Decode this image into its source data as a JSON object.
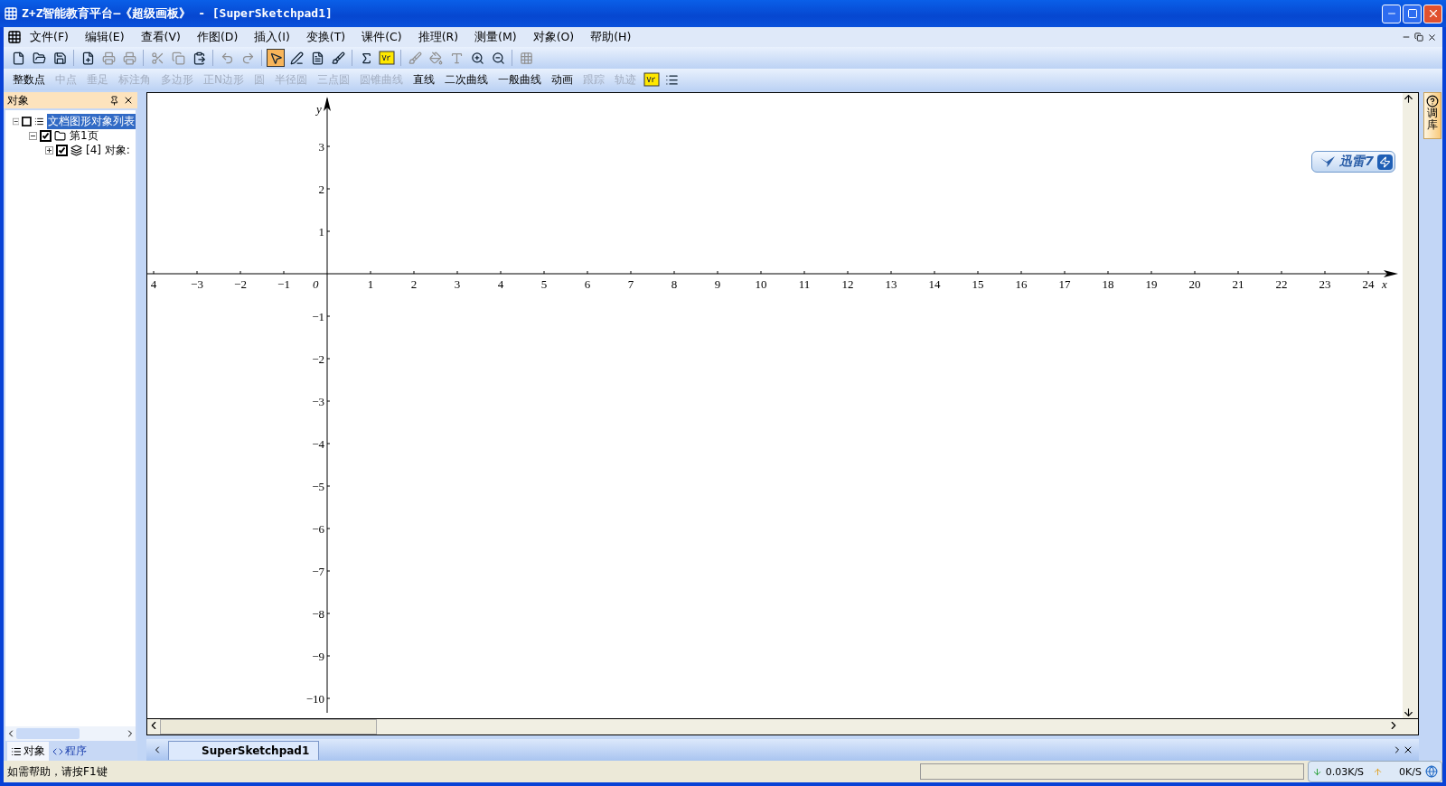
{
  "window": {
    "title": "Z+Z智能教育平台—《超级画板》 - [SuperSketchpad1]"
  },
  "menu": [
    "文件(F)",
    "编辑(E)",
    "查看(V)",
    "作图(D)",
    "插入(I)",
    "变换(T)",
    "课件(C)",
    "推理(R)",
    "测量(M)",
    "对象(O)",
    "帮助(H)"
  ],
  "toolbar": [
    {
      "kind": "new",
      "disabled": false
    },
    {
      "kind": "open",
      "disabled": false
    },
    {
      "kind": "save",
      "disabled": false
    },
    {
      "kind": "sep"
    },
    {
      "kind": "page",
      "disabled": false
    },
    {
      "kind": "print",
      "disabled": true
    },
    {
      "kind": "print",
      "disabled": true
    },
    {
      "kind": "sep"
    },
    {
      "kind": "cut",
      "disabled": true
    },
    {
      "kind": "copy",
      "disabled": true
    },
    {
      "kind": "paste",
      "disabled": false
    },
    {
      "kind": "sep"
    },
    {
      "kind": "undo",
      "disabled": true
    },
    {
      "kind": "redo",
      "disabled": true
    },
    {
      "kind": "sep"
    },
    {
      "kind": "pointer",
      "disabled": false,
      "selected": true
    },
    {
      "kind": "pen",
      "disabled": false,
      "selected": false
    },
    {
      "kind": "doc",
      "disabled": false,
      "selected": false
    },
    {
      "kind": "brush",
      "disabled": false,
      "selected": false
    },
    {
      "kind": "sep"
    },
    {
      "kind": "formula",
      "disabled": false
    },
    {
      "kind": "var",
      "disabled": false
    },
    {
      "kind": "sep"
    },
    {
      "kind": "brush",
      "disabled": true
    },
    {
      "kind": "fill",
      "disabled": true
    },
    {
      "kind": "font",
      "disabled": true
    },
    {
      "kind": "zoomin",
      "disabled": false
    },
    {
      "kind": "zoomout",
      "disabled": false
    },
    {
      "kind": "sep"
    },
    {
      "kind": "grid",
      "disabled": true
    }
  ],
  "toolbar2": [
    {
      "kind": "text",
      "label": "整数点",
      "disabled": false
    },
    {
      "kind": "text",
      "label": "中点",
      "disabled": true
    },
    {
      "kind": "text",
      "label": "垂足",
      "disabled": true
    },
    {
      "kind": "text",
      "label": "标注角",
      "disabled": true
    },
    {
      "kind": "text",
      "label": "多边形",
      "disabled": true
    },
    {
      "kind": "text",
      "label": "正N边形",
      "disabled": true
    },
    {
      "kind": "text",
      "label": "圆",
      "disabled": true
    },
    {
      "kind": "text",
      "label": "半径圆",
      "disabled": true
    },
    {
      "kind": "text",
      "label": "三点圆",
      "disabled": true
    },
    {
      "kind": "text",
      "label": "圆锥曲线",
      "disabled": true
    },
    {
      "kind": "text",
      "label": "直线",
      "disabled": false
    },
    {
      "kind": "text",
      "label": "二次曲线",
      "disabled": false
    },
    {
      "kind": "text",
      "label": "一般曲线",
      "disabled": false
    },
    {
      "kind": "text",
      "label": "动画",
      "disabled": false
    },
    {
      "kind": "text",
      "label": "跟踪",
      "disabled": true
    },
    {
      "kind": "text",
      "label": "轨迹",
      "disabled": true
    },
    {
      "kind": "var"
    },
    {
      "kind": "list"
    }
  ],
  "panel": {
    "title": "对象",
    "tree": [
      {
        "label": "文档图形对象列表",
        "checked": false,
        "selected": true,
        "expanded": true,
        "kind": "list",
        "children": [
          {
            "label": "第1页",
            "checked": true,
            "selected": false,
            "expanded": true,
            "kind": "folder",
            "children": [
              {
                "label": "[4] 对象:",
                "checked": true,
                "selected": false,
                "expanded": false,
                "kind": "objects"
              }
            ]
          }
        ]
      }
    ],
    "tabs": [
      {
        "label": "对象",
        "selected": true
      },
      {
        "label": "程序",
        "selected": false
      }
    ]
  },
  "axes": {
    "x_label": "x",
    "y_label": "y",
    "origin": "0",
    "x_ticks": [
      "4",
      "−3",
      "−2",
      "−1",
      "1",
      "2",
      "3",
      "4",
      "5",
      "6",
      "7",
      "8",
      "9",
      "10",
      "11",
      "12",
      "13",
      "14",
      "15",
      "16",
      "17",
      "18",
      "19",
      "20",
      "21",
      "22",
      "23",
      "24"
    ],
    "y_ticks": [
      "3",
      "2",
      "1",
      "−1",
      "−2",
      "−3",
      "−4",
      "−5",
      "−6",
      "−7",
      "−8",
      "−9",
      "−10"
    ]
  },
  "badge": {
    "label": "迅雷7"
  },
  "side_tab": {
    "label": "调库"
  },
  "doc_tabs": [
    {
      "label": "SuperSketchpad1",
      "selected": true
    }
  ],
  "status_bar": {
    "text": "如需帮助，请按F1键",
    "down": "0.03K/S",
    "up": "0K/S"
  }
}
